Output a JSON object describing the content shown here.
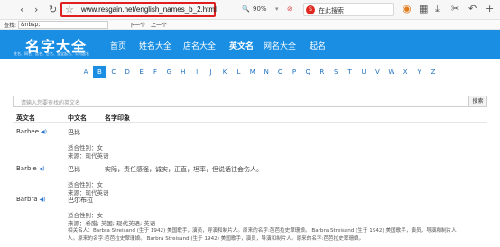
{
  "browser": {
    "url": "www.resgain.net/english_names_b_2.html",
    "zoom": "90%",
    "search_placeholder": "在此搜索",
    "icons": [
      "back-icon",
      "forward-icon",
      "refresh-icon",
      "home-icon",
      "star-icon",
      "zoom-icon",
      "block-icon",
      "search-engine-icon",
      "game-icon",
      "apps-icon",
      "download-icon",
      "cut-icon",
      "undo-icon",
      "add-icon"
    ]
  },
  "findbar": {
    "label": "查找:",
    "value": "&nbsp;",
    "next": "下一个",
    "prev": "上一个"
  },
  "site": {
    "logo": "名字大全",
    "logo_sub": "姓名、网名、店名、企名、宝宝起名、公司起名",
    "menu": [
      "首页",
      "姓名大全",
      "店名大全",
      "英文名",
      "网名大全",
      "起名"
    ],
    "active_menu": "英文名"
  },
  "alphabet": [
    "A",
    "B",
    "C",
    "D",
    "E",
    "F",
    "G",
    "H",
    "I",
    "J",
    "K",
    "L",
    "M",
    "N",
    "O",
    "P",
    "Q",
    "R",
    "S",
    "T",
    "U",
    "V",
    "W",
    "X",
    "Y",
    "Z"
  ],
  "active_letter": "B",
  "search": {
    "placeholder": "请输入您要查找的英文名",
    "button": "搜索"
  },
  "table": {
    "headers": [
      "英文名",
      "中文名",
      "名字印象"
    ],
    "rows": [
      {
        "en": "Barbee",
        "cn": "巴比",
        "impression": "",
        "gender": "适合性别：女",
        "source": "来源：现代英语",
        "meaning": ""
      },
      {
        "en": "Barbie",
        "cn": "巴比",
        "impression": "实际，责任感强，诚实，正直，坦率，但说话往会伤人。",
        "gender": "适合性别：女",
        "source": "来源：现代英语",
        "meaning": ""
      },
      {
        "en": "Barbra",
        "cn": "巴尔布拉",
        "impression": "",
        "gender": "适合性别：女",
        "source": "来源：希腊; 英国; 现代英语; 英语",
        "meaning_line1": "相关名人：Barbra Streisand (生于 1942) 美国歌手，演员，导演和制片人。原来的名字:芭芭拉史翠珊娘。 Barbra Streisand (生于 1942) 美国歌手，演员，导演和制片人",
        "meaning_line2": "人。原来的名字:芭芭拉史翠珊娘。 Barbra Streisand (生于 1942) 美国歌手，演员，导演和制片人。原来的名字:芭芭拉史翠珊娘。"
      }
    ]
  }
}
